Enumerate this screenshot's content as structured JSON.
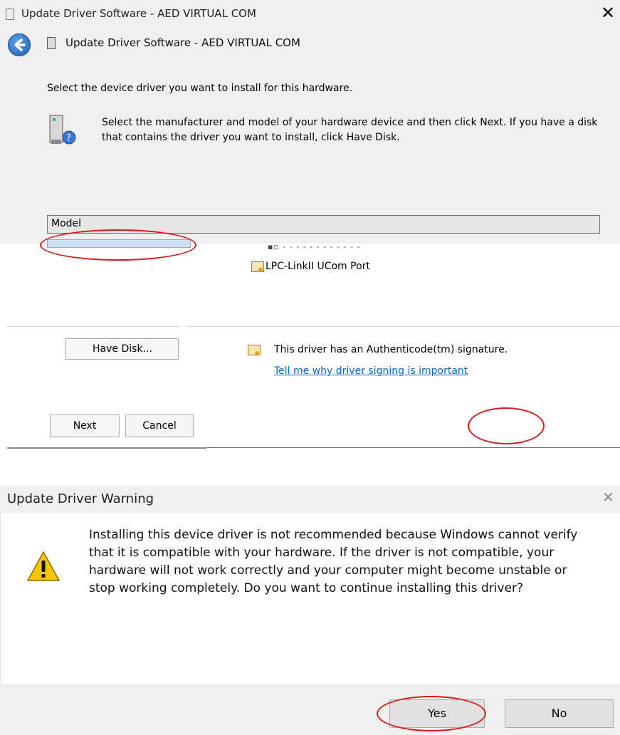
{
  "window1": {
    "title": "Update Driver Software - AED VIRTUAL COM",
    "close_glyph": "✕",
    "nav_title": "Update Driver Software - AED VIRTUAL COM",
    "instruction": "Select the device driver you want to install for this hardware.",
    "description": "Select the manufacturer and model of your hardware device and then click Next. If you have a disk that contains the driver you want to install, click Have Disk.",
    "model_header": "Model",
    "list_items": [
      {
        "label": "LPC-LinkII UCom Port",
        "icon": "driver-icon"
      }
    ],
    "have_disk_label": "Have Disk...",
    "authenticode_text": "This driver has an Authenticode(tm) signature.",
    "signing_link": "Tell me why driver signing is important",
    "next_label": "Next",
    "cancel_label": "Cancel"
  },
  "warning_dialog": {
    "title": "Update Driver Warning",
    "close_glyph": "✕",
    "message": "Installing this device driver is not recommended because Windows cannot verify that it is compatible with your hardware.  If the driver is not compatible, your hardware will not work correctly and your computer might become unstable or stop working completely.  Do you want to continue installing this driver?",
    "yes_label": "Yes",
    "no_label": "No",
    "icon": "warning-icon"
  },
  "colors": {
    "annotation_red": "#d81c1c",
    "link_blue": "#0066cc",
    "chrome_gray": "#f0f0f0"
  }
}
